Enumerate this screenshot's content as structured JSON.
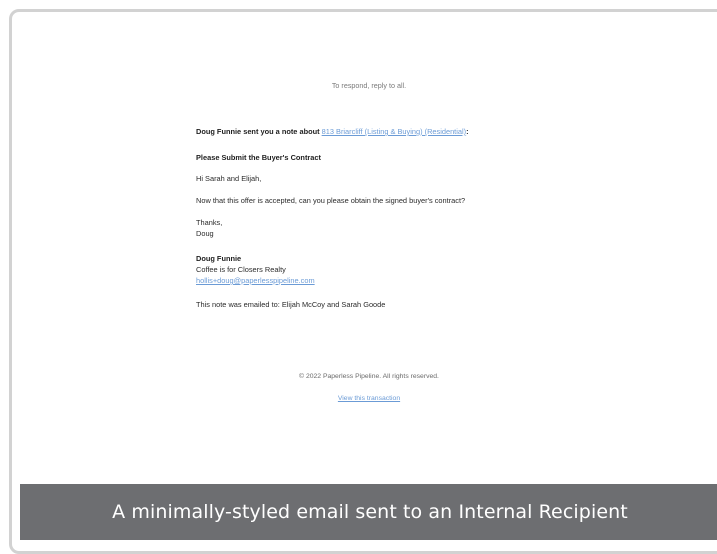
{
  "email": {
    "respond_note": "To respond, reply to all.",
    "intro_sender": "Doug Funnie sent you a note about ",
    "intro_link": "813 Briarcliff (Listing & Buying) (Residential)",
    "intro_suffix": ":",
    "subject": "Please Submit the Buyer's Contract",
    "greeting": "Hi Sarah and Elijah,",
    "body_line": "Now that this offer is accepted, can you please obtain the signed buyer's contract?",
    "signoff": "Thanks,",
    "signoff_name": "Doug",
    "signature": {
      "name": "Doug Funnie",
      "company": "Coffee is for Closers Realty",
      "email": "hollis+doug@paperlesspipeline.com"
    },
    "recipients_note": "This note was emailed to: Elijah McCoy and Sarah Goode",
    "footer_copyright": "© 2022 Paperless Pipeline. All rights reserved.",
    "footer_link": "View this transaction"
  },
  "caption": "A minimally-styled email sent to an Internal Recipient"
}
